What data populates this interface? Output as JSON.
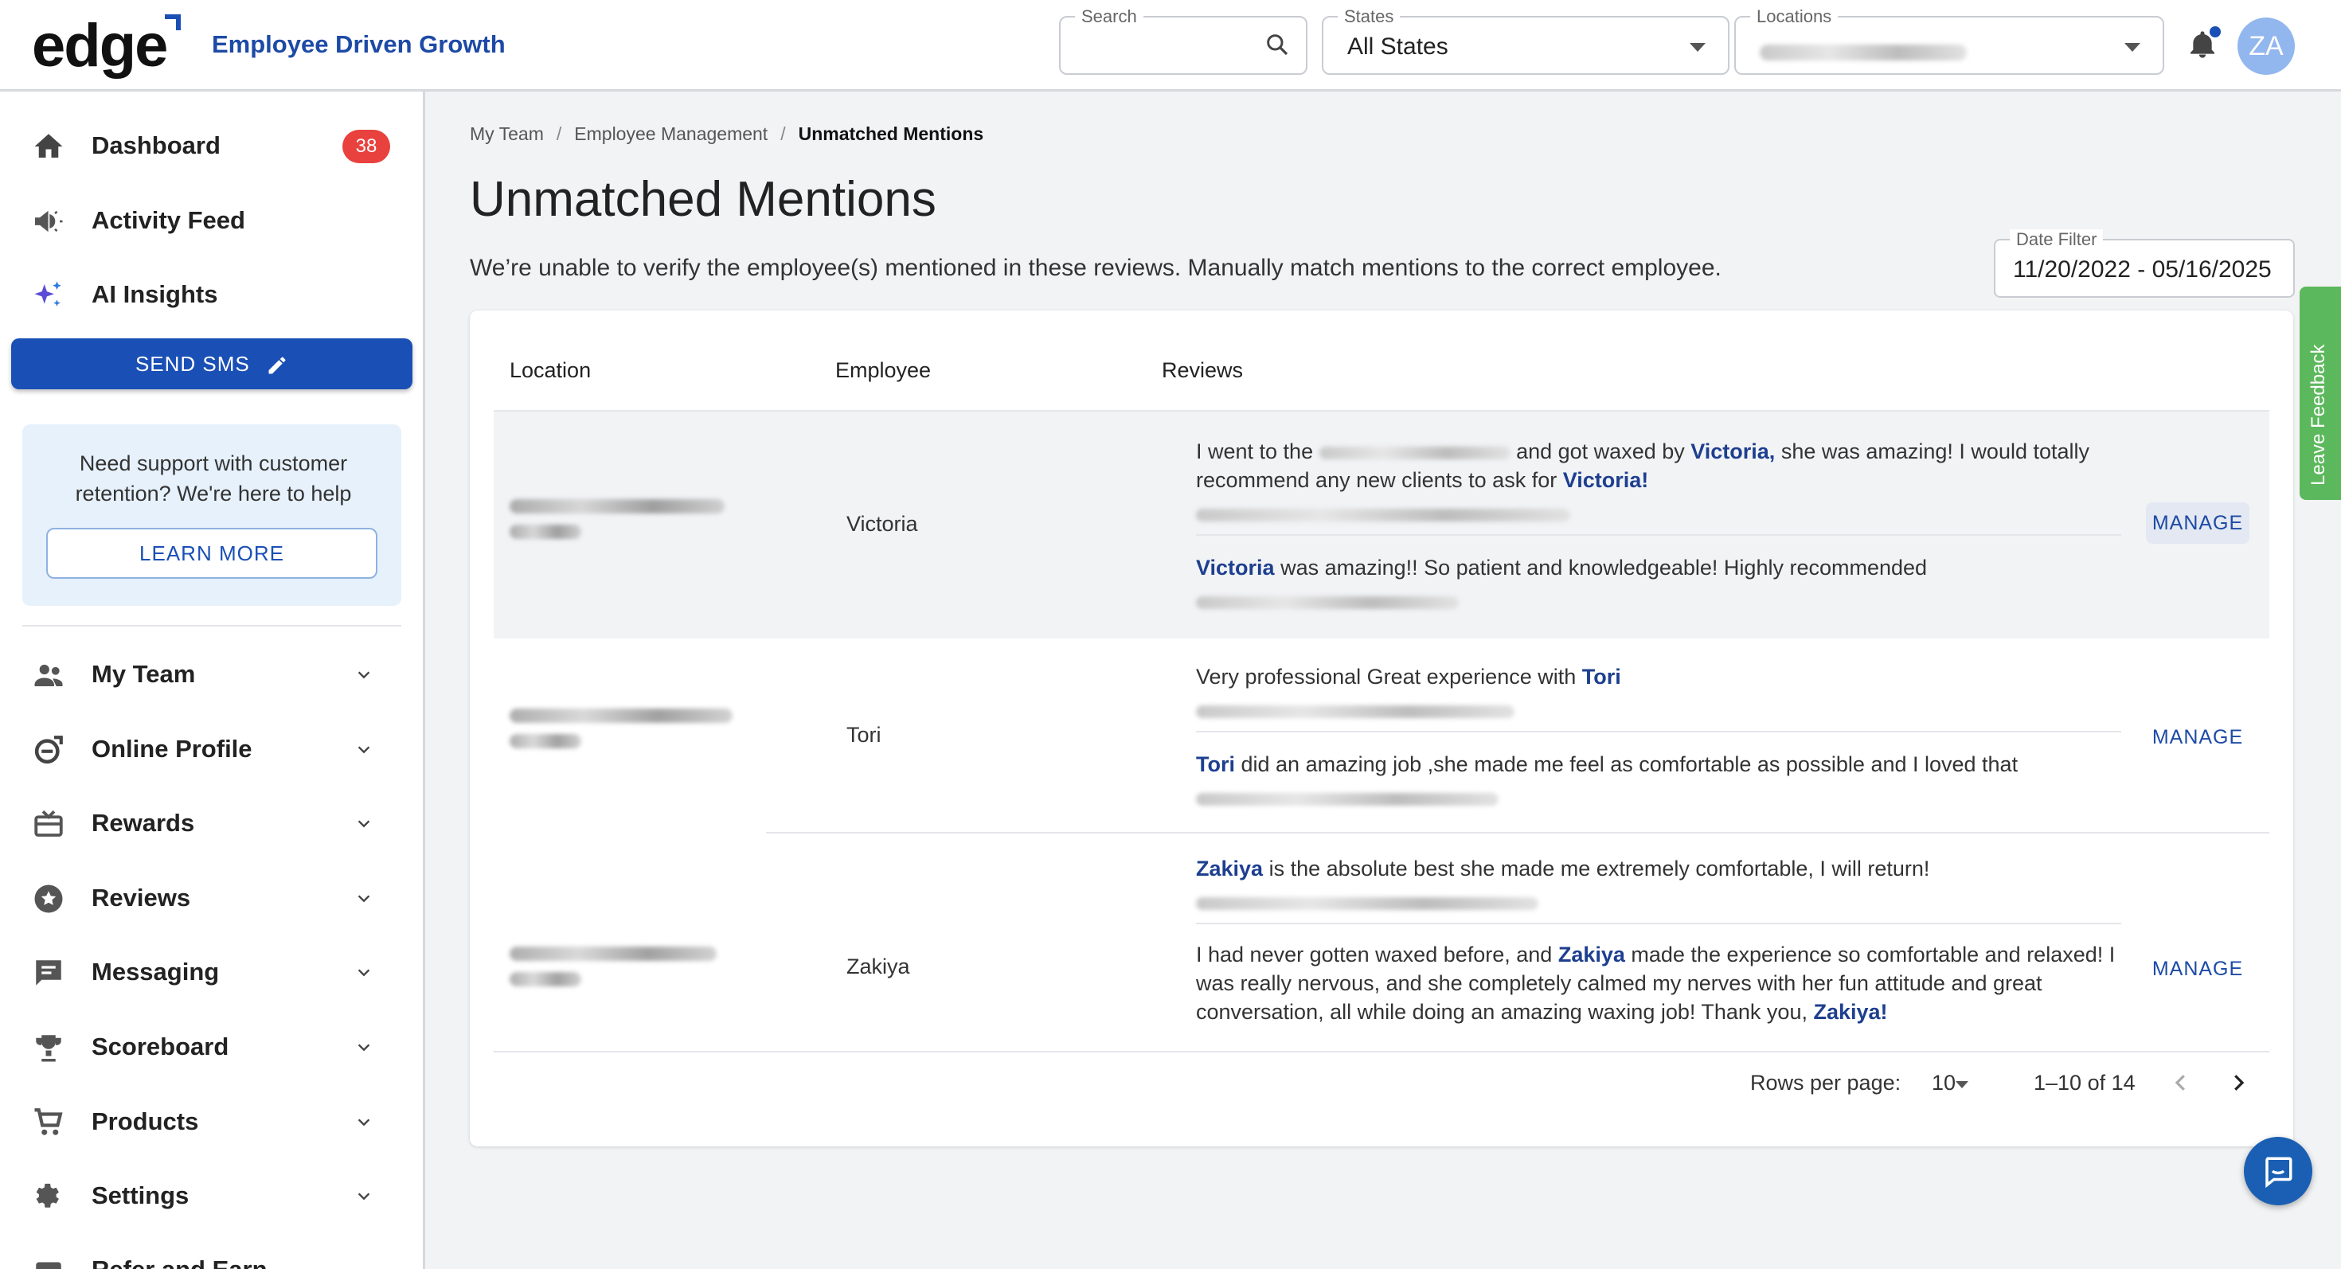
{
  "header": {
    "logo": "edge",
    "tagline": "Employee Driven Growth",
    "search": {
      "label": "Search",
      "value": ""
    },
    "states": {
      "label": "States",
      "value": "All States"
    },
    "locations": {
      "label": "Locations"
    },
    "avatar": "ZA"
  },
  "sidebar": {
    "dashboard": {
      "label": "Dashboard",
      "badge": "38"
    },
    "activity": {
      "label": "Activity Feed"
    },
    "ai": {
      "label": "AI Insights"
    },
    "send_sms": "SEND SMS",
    "support_text": "Need support with customer retention? We're here to help",
    "learn_more": "LEARN MORE",
    "groups": [
      {
        "label": "My Team"
      },
      {
        "label": "Online Profile"
      },
      {
        "label": "Rewards"
      },
      {
        "label": "Reviews"
      },
      {
        "label": "Messaging"
      },
      {
        "label": "Scoreboard"
      },
      {
        "label": "Products"
      },
      {
        "label": "Settings"
      },
      {
        "label": "Refer and Earn"
      }
    ]
  },
  "breadcrumb": {
    "b1": "My Team",
    "b2": "Employee Management",
    "b3": "Unmatched Mentions"
  },
  "page": {
    "title": "Unmatched Mentions",
    "subtitle": "We’re unable to verify the employee(s) mentioned in these reviews. Manually match mentions to the correct employee.",
    "date_filter_label": "Date Filter",
    "date_filter_value": "11/20/2022 - 05/16/2025"
  },
  "table": {
    "headers": {
      "location": "Location",
      "employee": "Employee",
      "reviews": "Reviews"
    },
    "manage_label": "MANAGE",
    "rows": [
      {
        "employee": "Victoria",
        "r1": {
          "t1": "I went to the ",
          "t2": " and got waxed by ",
          "n1": "Victoria,",
          "t3": " she was amazing! I would totally recommend any new clients to ask for ",
          "n2": "Victoria!"
        },
        "r2": {
          "n1": "Victoria",
          "t1": " was amazing!! So patient and knowledgeable! Highly recommended"
        }
      },
      {
        "employee": "Tori",
        "r1": {
          "t1": "Very professional Great experience with ",
          "n1": "Tori"
        },
        "r2": {
          "n1": "Tori",
          "t1": " did an amazing job ,she made me feel as comfortable as possible and I loved that"
        }
      },
      {
        "employee": "Zakiya",
        "r1": {
          "n1": "Zakiya",
          "t1": " is the absolute best she made me extremely comfortable, I will return!"
        },
        "r2": {
          "t1": "I had never gotten waxed before, and ",
          "n1": "Zakiya",
          "t2": " made the experience so comfortable and relaxed! I was really nervous, and she completely calmed my nerves with her fun attitude and great conversation, all while doing an amazing waxing job! Thank you, ",
          "n2": "Zakiya!"
        }
      }
    ]
  },
  "pagination": {
    "rows_label": "Rows per page:",
    "rows_value": "10",
    "range": "1–10 of 14"
  },
  "feedback": "Leave Feedback",
  "colors": {
    "primary": "#1a4fb5",
    "badge": "#e8413e",
    "feedback": "#5cb85c",
    "mention": "#1d3f8f"
  }
}
